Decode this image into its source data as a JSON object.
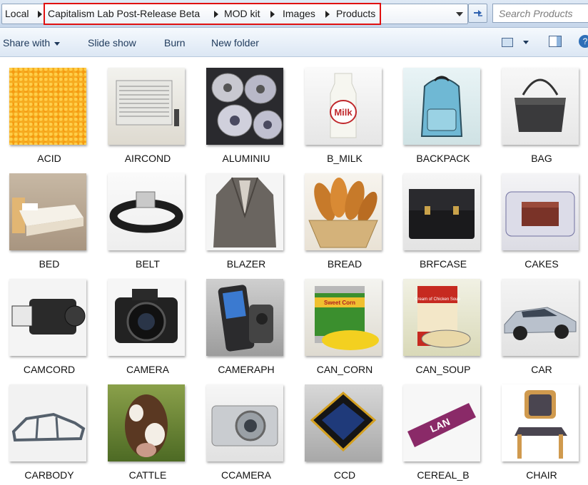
{
  "address": {
    "crumbs": [
      "Local",
      "Capitalism Lab Post-Release Beta",
      "MOD kit",
      "Images",
      "Products"
    ]
  },
  "search": {
    "placeholder": "Search Products"
  },
  "toolbar": {
    "share_label": "Share with",
    "slideshow_label": "Slide show",
    "burn_label": "Burn",
    "new_folder_label": "New folder"
  },
  "products": [
    {
      "name": "ACID",
      "icon": "acid-granules-image"
    },
    {
      "name": "AIRCOND",
      "icon": "air-conditioner-image"
    },
    {
      "name": "ALUMINIU",
      "icon": "aluminium-rolls-image"
    },
    {
      "name": "B_MILK",
      "icon": "milk-bottle-image"
    },
    {
      "name": "BACKPACK",
      "icon": "backpack-image"
    },
    {
      "name": "BAG",
      "icon": "handbag-image"
    },
    {
      "name": "BED",
      "icon": "bed-image"
    },
    {
      "name": "BELT",
      "icon": "belt-image"
    },
    {
      "name": "BLAZER",
      "icon": "blazer-image"
    },
    {
      "name": "BREAD",
      "icon": "bread-basket-image"
    },
    {
      "name": "BRFCASE",
      "icon": "briefcase-image"
    },
    {
      "name": "CAKES",
      "icon": "cakes-tray-image"
    },
    {
      "name": "CAMCORD",
      "icon": "camcorder-image"
    },
    {
      "name": "CAMERA",
      "icon": "camera-image"
    },
    {
      "name": "CAMERAPH",
      "icon": "camera-phone-image"
    },
    {
      "name": "CAN_CORN",
      "icon": "corn-can-image"
    },
    {
      "name": "CAN_SOUP",
      "icon": "soup-can-image"
    },
    {
      "name": "CAR",
      "icon": "car-image"
    },
    {
      "name": "CARBODY",
      "icon": "car-body-image"
    },
    {
      "name": "CATTLE",
      "icon": "cattle-image"
    },
    {
      "name": "CCAMERA",
      "icon": "compact-camera-image"
    },
    {
      "name": "CCD",
      "icon": "ccd-chip-image"
    },
    {
      "name": "CEREAL_B",
      "icon": "cereal-bar-image"
    },
    {
      "name": "CHAIR",
      "icon": "chair-image"
    }
  ],
  "thumb_text": {
    "milk": "Milk",
    "cereal": "LAN",
    "corn": "Sweet Corn",
    "soup": "Cream of Chicken Soup"
  }
}
